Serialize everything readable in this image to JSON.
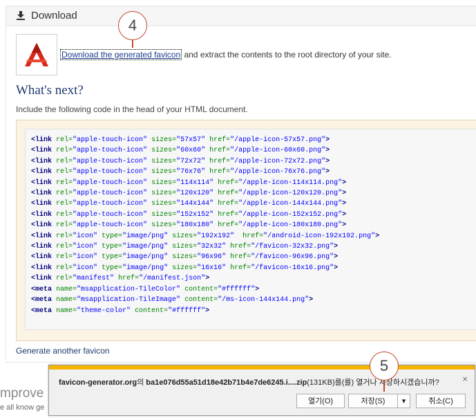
{
  "panel": {
    "title": "Download",
    "download_link": "Download the generated favicon",
    "download_rest": " and extract the contents to the root directory of your site.",
    "whats_next": "What's next?",
    "include_text": "Include the following code in the head of your HTML document.",
    "generate_another": "Generate another favicon"
  },
  "code_lines": [
    [
      [
        "<link ",
        "tag"
      ],
      [
        "rel=",
        "attr"
      ],
      [
        "\"apple-touch-icon\" ",
        "val"
      ],
      [
        "sizes=",
        "attr"
      ],
      [
        "\"57x57\" ",
        "val"
      ],
      [
        "href=",
        "attr"
      ],
      [
        "\"/apple-icon-57x57.png\"",
        "val"
      ],
      [
        ">",
        "tag"
      ]
    ],
    [
      [
        "<link ",
        "tag"
      ],
      [
        "rel=",
        "attr"
      ],
      [
        "\"apple-touch-icon\" ",
        "val"
      ],
      [
        "sizes=",
        "attr"
      ],
      [
        "\"60x60\" ",
        "val"
      ],
      [
        "href=",
        "attr"
      ],
      [
        "\"/apple-icon-60x60.png\"",
        "val"
      ],
      [
        ">",
        "tag"
      ]
    ],
    [
      [
        "<link ",
        "tag"
      ],
      [
        "rel=",
        "attr"
      ],
      [
        "\"apple-touch-icon\" ",
        "val"
      ],
      [
        "sizes=",
        "attr"
      ],
      [
        "\"72x72\" ",
        "val"
      ],
      [
        "href=",
        "attr"
      ],
      [
        "\"/apple-icon-72x72.png\"",
        "val"
      ],
      [
        ">",
        "tag"
      ]
    ],
    [
      [
        "<link ",
        "tag"
      ],
      [
        "rel=",
        "attr"
      ],
      [
        "\"apple-touch-icon\" ",
        "val"
      ],
      [
        "sizes=",
        "attr"
      ],
      [
        "\"76x76\" ",
        "val"
      ],
      [
        "href=",
        "attr"
      ],
      [
        "\"/apple-icon-76x76.png\"",
        "val"
      ],
      [
        ">",
        "tag"
      ]
    ],
    [
      [
        "<link ",
        "tag"
      ],
      [
        "rel=",
        "attr"
      ],
      [
        "\"apple-touch-icon\" ",
        "val"
      ],
      [
        "sizes=",
        "attr"
      ],
      [
        "\"114x114\" ",
        "val"
      ],
      [
        "href=",
        "attr"
      ],
      [
        "\"/apple-icon-114x114.png\"",
        "val"
      ],
      [
        ">",
        "tag"
      ]
    ],
    [
      [
        "<link ",
        "tag"
      ],
      [
        "rel=",
        "attr"
      ],
      [
        "\"apple-touch-icon\" ",
        "val"
      ],
      [
        "sizes=",
        "attr"
      ],
      [
        "\"120x120\" ",
        "val"
      ],
      [
        "href=",
        "attr"
      ],
      [
        "\"/apple-icon-120x120.png\"",
        "val"
      ],
      [
        ">",
        "tag"
      ]
    ],
    [
      [
        "<link ",
        "tag"
      ],
      [
        "rel=",
        "attr"
      ],
      [
        "\"apple-touch-icon\" ",
        "val"
      ],
      [
        "sizes=",
        "attr"
      ],
      [
        "\"144x144\" ",
        "val"
      ],
      [
        "href=",
        "attr"
      ],
      [
        "\"/apple-icon-144x144.png\"",
        "val"
      ],
      [
        ">",
        "tag"
      ]
    ],
    [
      [
        "<link ",
        "tag"
      ],
      [
        "rel=",
        "attr"
      ],
      [
        "\"apple-touch-icon\" ",
        "val"
      ],
      [
        "sizes=",
        "attr"
      ],
      [
        "\"152x152\" ",
        "val"
      ],
      [
        "href=",
        "attr"
      ],
      [
        "\"/apple-icon-152x152.png\"",
        "val"
      ],
      [
        ">",
        "tag"
      ]
    ],
    [
      [
        "<link ",
        "tag"
      ],
      [
        "rel=",
        "attr"
      ],
      [
        "\"apple-touch-icon\" ",
        "val"
      ],
      [
        "sizes=",
        "attr"
      ],
      [
        "\"180x180\" ",
        "val"
      ],
      [
        "href=",
        "attr"
      ],
      [
        "\"/apple-icon-180x180.png\"",
        "val"
      ],
      [
        ">",
        "tag"
      ]
    ],
    [
      [
        "<link ",
        "tag"
      ],
      [
        "rel=",
        "attr"
      ],
      [
        "\"icon\" ",
        "val"
      ],
      [
        "type=",
        "attr"
      ],
      [
        "\"image/png\" ",
        "val"
      ],
      [
        "sizes=",
        "attr"
      ],
      [
        "\"192x192\"  ",
        "val"
      ],
      [
        "href=",
        "attr"
      ],
      [
        "\"/android-icon-192x192.png\"",
        "val"
      ],
      [
        ">",
        "tag"
      ]
    ],
    [
      [
        "<link ",
        "tag"
      ],
      [
        "rel=",
        "attr"
      ],
      [
        "\"icon\" ",
        "val"
      ],
      [
        "type=",
        "attr"
      ],
      [
        "\"image/png\" ",
        "val"
      ],
      [
        "sizes=",
        "attr"
      ],
      [
        "\"32x32\" ",
        "val"
      ],
      [
        "href=",
        "attr"
      ],
      [
        "\"/favicon-32x32.png\"",
        "val"
      ],
      [
        ">",
        "tag"
      ]
    ],
    [
      [
        "<link ",
        "tag"
      ],
      [
        "rel=",
        "attr"
      ],
      [
        "\"icon\" ",
        "val"
      ],
      [
        "type=",
        "attr"
      ],
      [
        "\"image/png\" ",
        "val"
      ],
      [
        "sizes=",
        "attr"
      ],
      [
        "\"96x96\" ",
        "val"
      ],
      [
        "href=",
        "attr"
      ],
      [
        "\"/favicon-96x96.png\"",
        "val"
      ],
      [
        ">",
        "tag"
      ]
    ],
    [
      [
        "<link ",
        "tag"
      ],
      [
        "rel=",
        "attr"
      ],
      [
        "\"icon\" ",
        "val"
      ],
      [
        "type=",
        "attr"
      ],
      [
        "\"image/png\" ",
        "val"
      ],
      [
        "sizes=",
        "attr"
      ],
      [
        "\"16x16\" ",
        "val"
      ],
      [
        "href=",
        "attr"
      ],
      [
        "\"/favicon-16x16.png\"",
        "val"
      ],
      [
        ">",
        "tag"
      ]
    ],
    [
      [
        "<link ",
        "tag"
      ],
      [
        "rel=",
        "attr"
      ],
      [
        "\"manifest\" ",
        "val"
      ],
      [
        "href=",
        "attr"
      ],
      [
        "\"/manifest.json\"",
        "val"
      ],
      [
        ">",
        "tag"
      ]
    ],
    [
      [
        "<meta ",
        "tag"
      ],
      [
        "name=",
        "attr"
      ],
      [
        "\"msapplication-TileColor\" ",
        "val"
      ],
      [
        "content=",
        "attr"
      ],
      [
        "\"#ffffff\"",
        "val"
      ],
      [
        ">",
        "tag"
      ]
    ],
    [
      [
        "<meta ",
        "tag"
      ],
      [
        "name=",
        "attr"
      ],
      [
        "\"msapplication-TileImage\" ",
        "val"
      ],
      [
        "content=",
        "attr"
      ],
      [
        "\"/ms-icon-144x144.png\"",
        "val"
      ],
      [
        ">",
        "tag"
      ]
    ],
    [
      [
        "<meta ",
        "tag"
      ],
      [
        "name=",
        "attr"
      ],
      [
        "\"theme-color\" ",
        "val"
      ],
      [
        "content=",
        "attr"
      ],
      [
        "\"#ffffff\"",
        "val"
      ],
      [
        ">",
        "tag"
      ]
    ]
  ],
  "background": {
    "improve": "mprove",
    "all_know": "e all know ge"
  },
  "annotations": {
    "step4": "4",
    "step5": "5"
  },
  "download_bar": {
    "site": "favicon-generator.org",
    "msg_mid": "의 ",
    "filename": "ba1e076d55a51d18e42b71b4e7de6245.i....zip",
    "msg_tail": "(131KB)를(를) 열거나 저장하시겠습니까?",
    "close": "×",
    "open_label": "열기(O)",
    "save_label": "저장(S)",
    "dropdown": "▾",
    "cancel_label": "취소(C)"
  },
  "colors": {
    "accent_bar": "#f5b400",
    "annotation": "#c2492b",
    "heading": "#1f3a6e",
    "logo_red": "#d9261c"
  },
  "icons": [
    "download-icon",
    "favicon-logo-icon",
    "close-icon",
    "chevron-down-icon"
  ]
}
